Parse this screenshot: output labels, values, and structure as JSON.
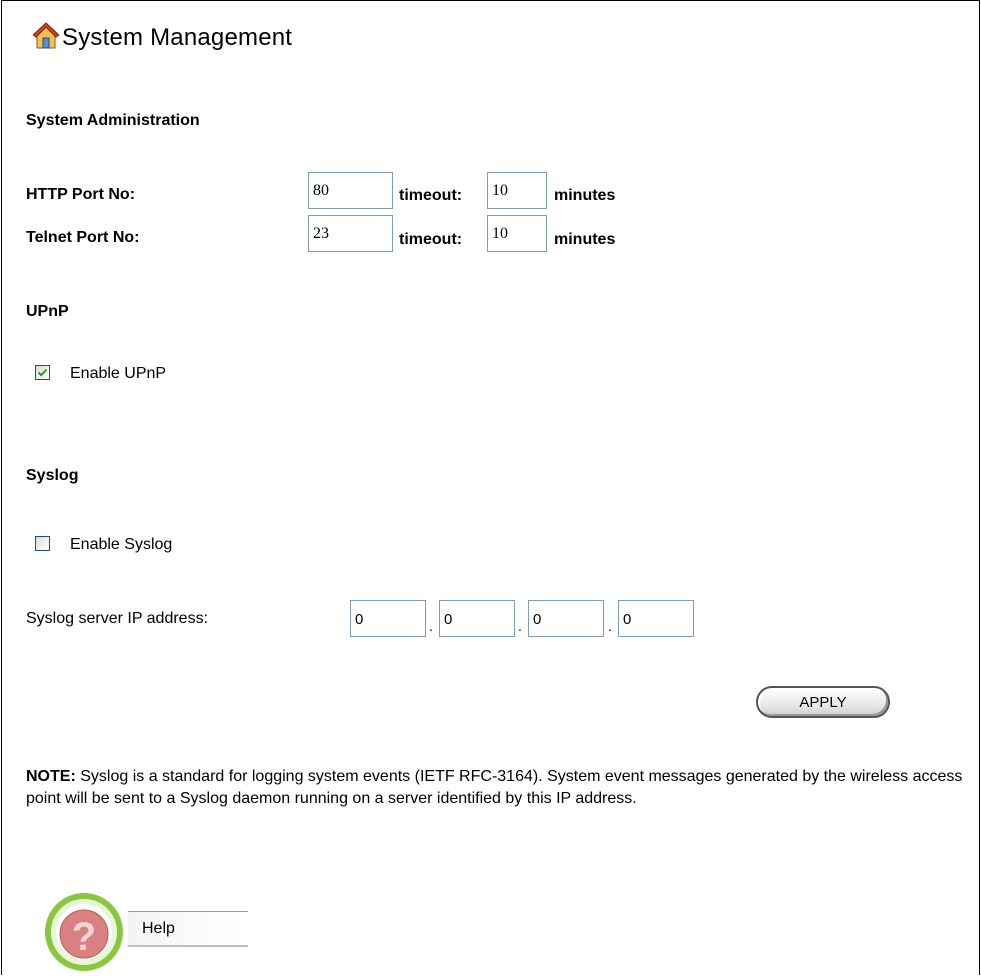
{
  "header": {
    "title": "System Management",
    "icon": "home-icon"
  },
  "administration": {
    "heading": "System Administration",
    "http": {
      "label": "HTTP Port No:",
      "port": "80",
      "timeout_label": "timeout:",
      "timeout": "10",
      "unit": "minutes"
    },
    "telnet": {
      "label": "Telnet Port No:",
      "port": "23",
      "timeout_label": "timeout:",
      "timeout": "10",
      "unit": "minutes"
    }
  },
  "upnp": {
    "heading": "UPnP",
    "checkbox_label": "Enable UPnP",
    "checked": true
  },
  "syslog": {
    "heading": "Syslog",
    "checkbox_label": "Enable Syslog",
    "checked": false,
    "ip_label": "Syslog server IP address:",
    "ip": [
      "0",
      "0",
      "0",
      "0"
    ],
    "dot": "."
  },
  "apply_label": "APPLY",
  "note": {
    "prefix": "NOTE:",
    "text": " Syslog is a standard for logging system events (IETF RFC-3164). System event messages generated by the wireless access point will be sent to a Syslog daemon running on a server identified by this IP address."
  },
  "help": {
    "label": "Help",
    "icon": "help-question-icon"
  },
  "colors": {
    "input_border": "#7f9db9",
    "check_mark": "#21a121",
    "help_ring": "#8ac640",
    "help_fill": "#d98080"
  }
}
